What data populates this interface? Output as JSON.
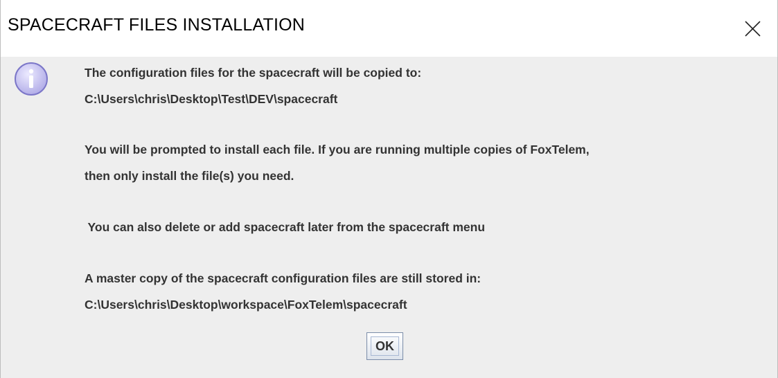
{
  "dialog": {
    "title": "SPACECRAFT FILES INSTALLATION",
    "icons": {
      "close": "close-icon",
      "info": "info-icon"
    },
    "message_lines": [
      "The configuration files for the spacecraft will be copied to:",
      "C:\\Users\\chris\\Desktop\\Test\\DEV\\spacecraft",
      "You will be prompted to install each file.  If you are running multiple copies of FoxTelem,",
      "then only install the file(s) you need.",
      " You can also delete or add spacecraft later from the spacecraft menu",
      "A master copy of the spacecraft configuration files are still stored in:",
      "C:\\Users\\chris\\Desktop\\workspace\\FoxTelem\\spacecraft"
    ],
    "ok_label": "OK"
  },
  "colors": {
    "titlebar_bg": "#ffffff",
    "content_bg": "#eeeeee",
    "text": "#333333",
    "info_icon_fill": "#c8c4f0",
    "info_icon_border": "#7b76c8"
  }
}
